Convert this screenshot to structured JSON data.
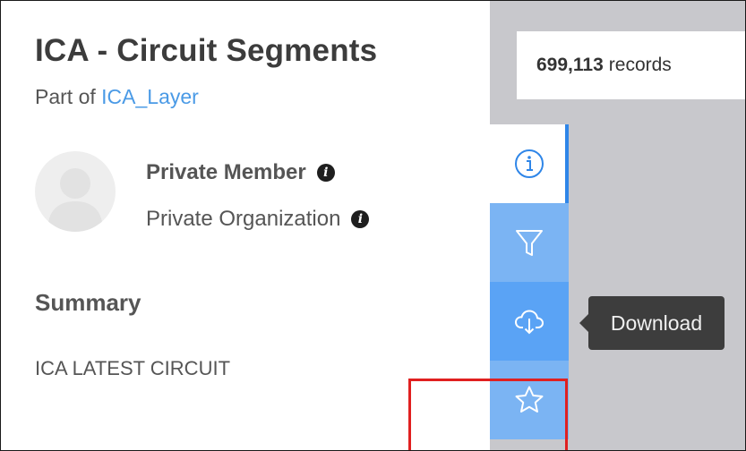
{
  "item": {
    "title": "ICA - Circuit Segments",
    "part_of_prefix": "Part of",
    "part_of_link": "ICA_Layer"
  },
  "owner": {
    "member": "Private Member",
    "organization": "Private Organization"
  },
  "summary": {
    "heading": "Summary",
    "text": "ICA LATEST CIRCUIT"
  },
  "toolbar": {
    "tools": [
      {
        "name": "info",
        "icon": "info-circle-icon"
      },
      {
        "name": "filter",
        "icon": "filter-icon"
      },
      {
        "name": "download",
        "icon": "cloud-download-icon"
      },
      {
        "name": "favorite",
        "icon": "star-icon"
      }
    ],
    "tooltip": "Download"
  },
  "records": {
    "count": "699,113",
    "label": "records"
  },
  "colors": {
    "accent": "#2f86e8",
    "link": "#4a9ae6",
    "tool_bg": "#7bb4f3",
    "tool_active_bg": "#5aa3f5",
    "tooltip_bg": "#3d3d3d",
    "highlight": "#e02020"
  }
}
